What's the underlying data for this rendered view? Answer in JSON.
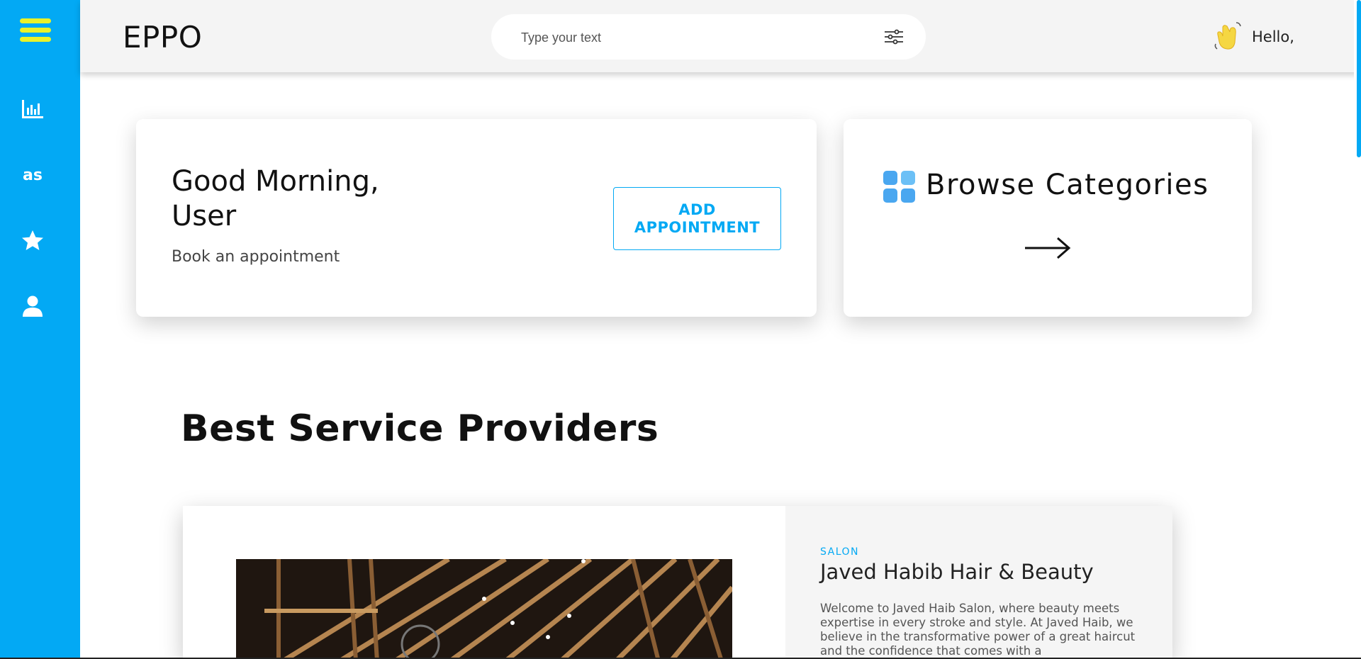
{
  "header": {
    "brand": "EPPO",
    "search_placeholder": "Type your text",
    "greeting": "Hello,"
  },
  "sidebar": {
    "icons": [
      "menu-icon",
      "chart-icon",
      "lastfm-icon",
      "star-icon",
      "user-icon"
    ]
  },
  "greeting_card": {
    "title_line1": "Good Morning,",
    "title_line2": "User",
    "subtitle": "Book an appointment",
    "button_line1": "ADD",
    "button_line2": "APPOINTMENT"
  },
  "categories_card": {
    "title": "Browse Categories"
  },
  "section": {
    "title": "Best Service Providers"
  },
  "provider": {
    "category": "SALON",
    "name": "Javed Habib Hair & Beauty",
    "description": "Welcome to Javed Haib Salon, where beauty meets expertise in every stroke and style. At Javed Haib, we believe in the transformative power of a great haircut and the confidence that comes with a"
  },
  "colors": {
    "accent": "#03a9f4",
    "menu_icon": "#e9f22a"
  }
}
